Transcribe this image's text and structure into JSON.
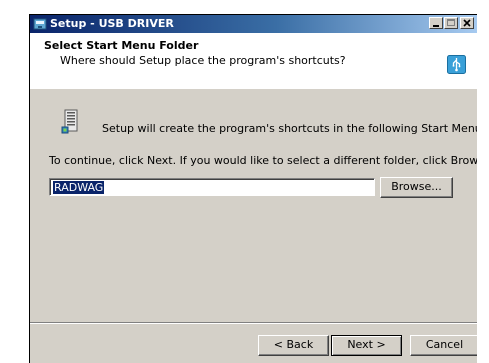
{
  "window": {
    "title": "Setup - USB DRIVER",
    "controls": [
      "minimize",
      "maximize",
      "close"
    ]
  },
  "header": {
    "title": "Select Start Menu Folder",
    "subtitle": "Where should Setup place the program's shortcuts?",
    "icon": "usb-setup-icon"
  },
  "body": {
    "intro_icon": "program-group-icon",
    "intro": "Setup will create the program's shortcuts in the following Start Menu folder.",
    "continue": "To continue, click Next. If you would like to select a different folder, click Browse.",
    "folder_value": "RADWAG",
    "browse_label": "Browse..."
  },
  "buttons": {
    "back": "< Back",
    "next": "Next >",
    "cancel": "Cancel"
  },
  "colors": {
    "title_bar_start": "#0a246a",
    "title_bar_end": "#a6caf0",
    "dialog_face": "#d4d0c8",
    "selection": "#0a246a"
  }
}
